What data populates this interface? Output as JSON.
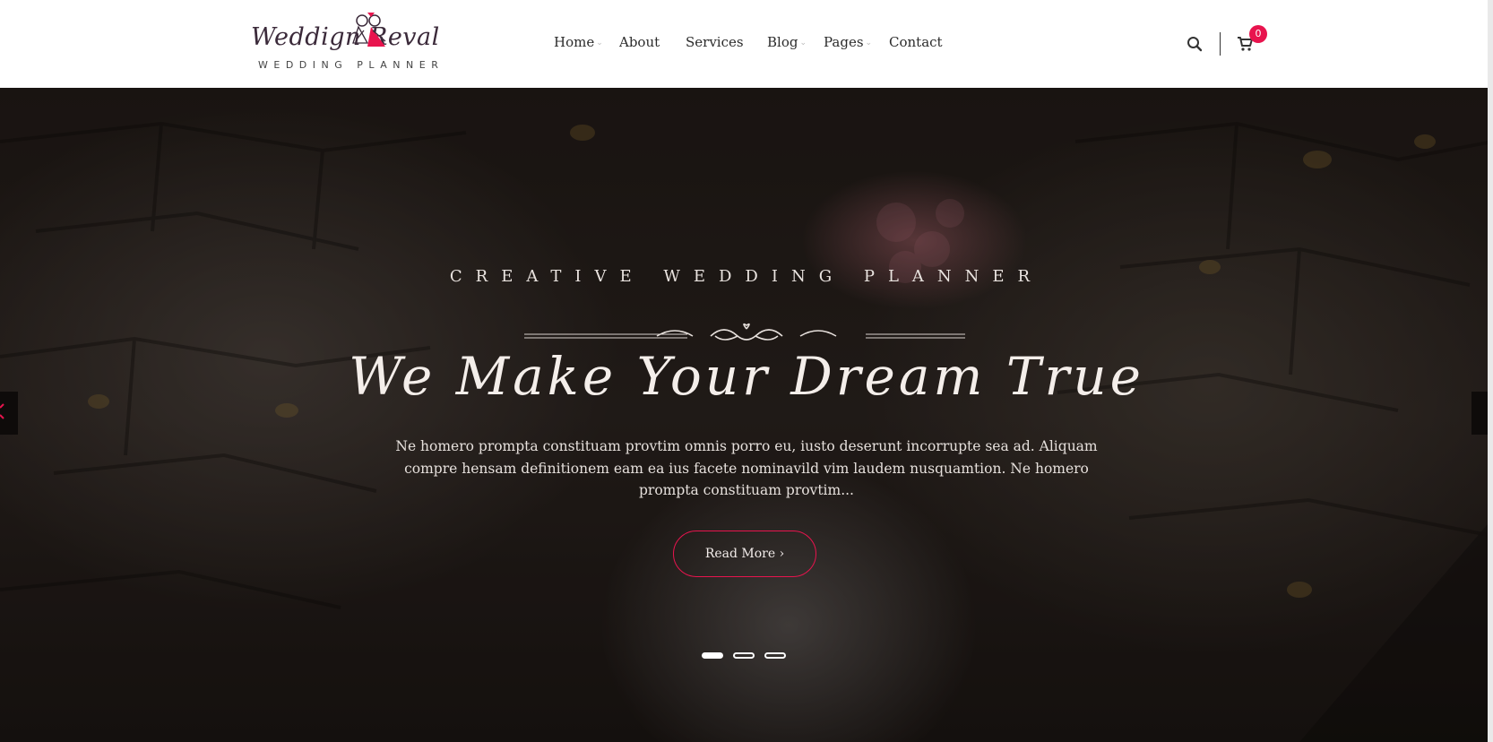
{
  "brand": {
    "name": "Weddign Reval",
    "tagline": "WEDDING PLANNER"
  },
  "nav": {
    "items": [
      {
        "label": "Home",
        "has_dropdown": true
      },
      {
        "label": "About",
        "has_dropdown": false
      },
      {
        "label": "Services",
        "has_dropdown": false
      },
      {
        "label": "Blog",
        "has_dropdown": true
      },
      {
        "label": "Pages",
        "has_dropdown": true
      },
      {
        "label": "Contact",
        "has_dropdown": false
      }
    ],
    "caret": "⌄"
  },
  "header_icons": {
    "search": "search-icon",
    "cart": "cart-icon",
    "cart_count": "0"
  },
  "hero": {
    "subtitle": "CREATIVE WEDDING PLANNER",
    "title": "We Make Your Dream True",
    "text": "Ne homero prompta constituam provtim omnis porro eu, iusto deserunt incorrupte sea ad. Aliquam compre hensam definitionem eam ea ius facete nominavild vim laudem nusquamtion. Ne homero prompta constituam provtim...",
    "button_label": "Read More ›",
    "slides_total": 3,
    "active_slide": 1
  },
  "colors": {
    "accent": "#e8144e",
    "header_bg": "#ffffff",
    "nav_text": "#2b2b2b",
    "hero_text": "#f4eeea"
  }
}
